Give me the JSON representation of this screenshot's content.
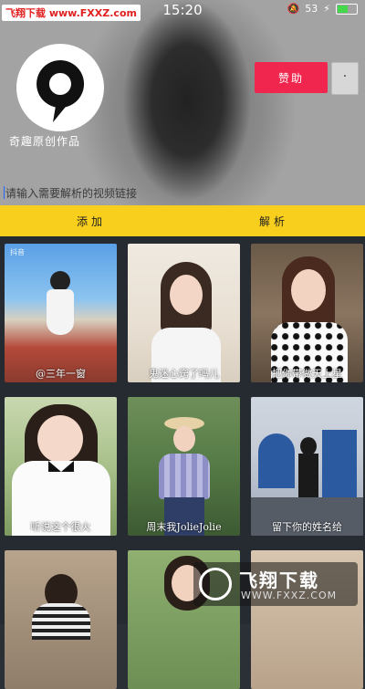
{
  "status_bar": {
    "watermark": "飞翔下载 www.FXXZ.com",
    "time": "15:20",
    "battery": "53",
    "battery_level": 0.53
  },
  "header": {
    "logo_text": "奇趣原创作品",
    "donate_label": "赞助",
    "more_label": "·"
  },
  "input": {
    "placeholder": "请输入需要解析的视频链接"
  },
  "actions": {
    "add_label": "添加",
    "parse_label": "解析"
  },
  "videos": [
    {
      "caption": "@三年一窗",
      "badge": "抖音"
    },
    {
      "caption": "鬼迷心窍了吗儿",
      "badge": ""
    },
    {
      "caption": "把你带做天上星",
      "badge": ""
    },
    {
      "caption": "听说这个很火",
      "badge": ""
    },
    {
      "caption": "周末我JolieJolie",
      "badge": ""
    },
    {
      "caption": "留下你的姓名给",
      "badge": ""
    },
    {
      "caption": "",
      "badge": ""
    },
    {
      "caption": "",
      "badge": ""
    },
    {
      "caption": "",
      "badge": ""
    }
  ],
  "bottom_watermark": {
    "title": "飞翔下载",
    "url": "WWW.FXXZ.COM"
  },
  "colors": {
    "accent_yellow": "#f8cf1c",
    "donate_red": "#f0264f",
    "grid_bg": "#262a31"
  }
}
